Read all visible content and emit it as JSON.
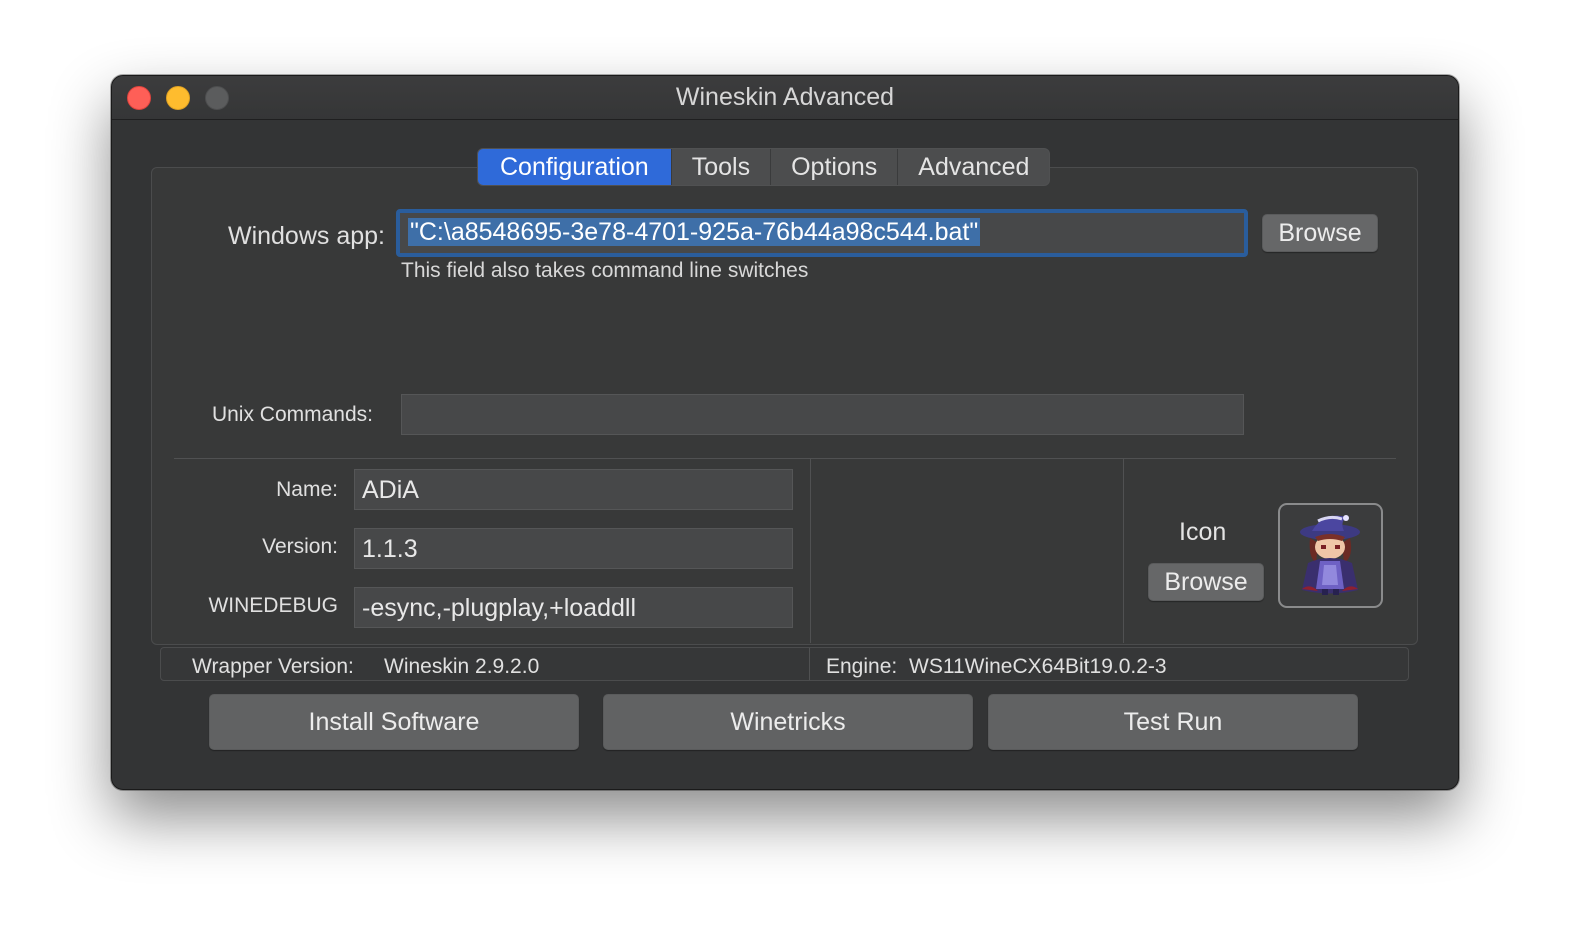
{
  "window": {
    "title": "Wineskin Advanced"
  },
  "tabs": [
    {
      "label": "Configuration",
      "active": true
    },
    {
      "label": "Tools",
      "active": false
    },
    {
      "label": "Options",
      "active": false
    },
    {
      "label": "Advanced",
      "active": false
    }
  ],
  "windows_app": {
    "label": "Windows app:",
    "value": "\"C:\\a8548695-3e78-4701-925a-76b44a98c544.bat\"",
    "hint": "This field also takes command line switches",
    "browse_label": "Browse"
  },
  "unix_commands": {
    "label": "Unix Commands:",
    "value": ""
  },
  "info": {
    "name_label": "Name:",
    "name_value": "ADiA",
    "version_label": "Version:",
    "version_value": "1.1.3",
    "winedebug_label": "WINEDEBUG",
    "winedebug_value": "-esync,-plugplay,+loaddll"
  },
  "icon": {
    "label": "Icon",
    "browse_label": "Browse"
  },
  "status": {
    "wrapper_label": "Wrapper Version:",
    "wrapper_value": "Wineskin 2.9.2.0",
    "engine_label": "Engine:",
    "engine_value": "WS11WineCX64Bit19.0.2-3"
  },
  "actions": {
    "install_label": "Install Software",
    "winetricks_label": "Winetricks",
    "testrun_label": "Test Run"
  },
  "colors": {
    "accent": "#2f6ad9",
    "focus_ring": "#2a5d9c",
    "background": "#333435"
  }
}
